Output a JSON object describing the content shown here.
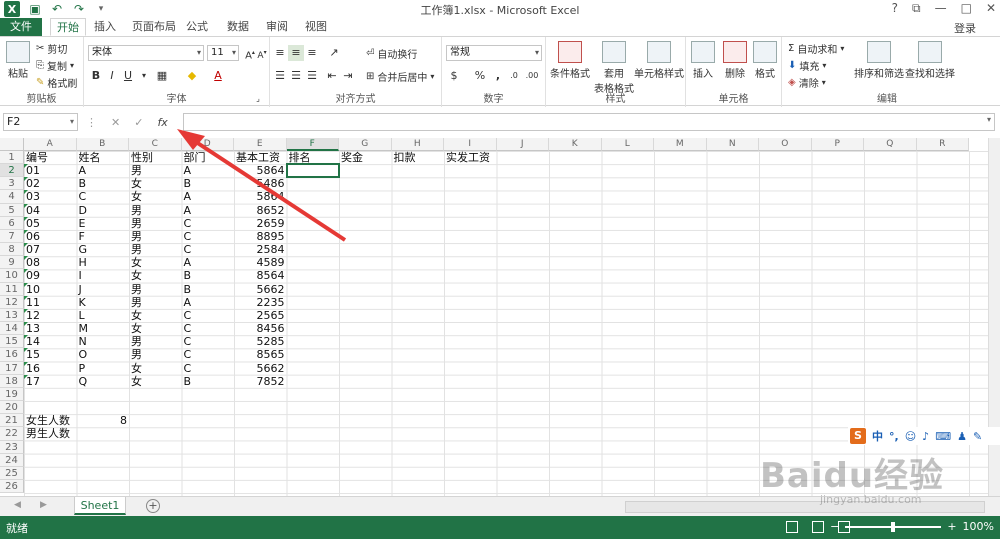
{
  "window": {
    "title": "工作簿1.xlsx - Microsoft Excel",
    "login": "登录",
    "help": "?"
  },
  "tabs": [
    "文件",
    "开始",
    "插入",
    "页面布局",
    "公式",
    "数据",
    "审阅",
    "视图"
  ],
  "ribbon": {
    "clipboard": {
      "label": "剪贴板",
      "paste": "粘贴",
      "cut": "剪切",
      "copy": "复制",
      "format_painter": "格式刷"
    },
    "font": {
      "label": "字体",
      "name": "宋体",
      "size": "11"
    },
    "alignment": {
      "label": "对齐方式",
      "wrap": "自动换行",
      "merge": "合并后居中"
    },
    "number": {
      "label": "数字",
      "format": "常规",
      "percent": "%"
    },
    "styles": {
      "label": "样式",
      "conditional": "条件格式",
      "table_format_1": "套用",
      "table_format_2": "表格格式",
      "cell_styles": "单元格样式"
    },
    "cells": {
      "label": "单元格",
      "insert": "插入",
      "delete": "删除",
      "format": "格式"
    },
    "editing": {
      "label": "编辑",
      "autosum": "自动求和",
      "fill": "填充",
      "clear": "清除",
      "sort_filter": "排序和筛选",
      "find_select": "查找和选择"
    }
  },
  "formula_bar": {
    "name_box": "F2",
    "fx": "fx",
    "content": ""
  },
  "columns": [
    "A",
    "B",
    "C",
    "D",
    "E",
    "F",
    "G",
    "H",
    "I",
    "J",
    "K",
    "L",
    "M",
    "N",
    "O",
    "P",
    "Q",
    "R"
  ],
  "selected_column": "F",
  "rows": [
    "1",
    "2",
    "3",
    "4",
    "5",
    "6",
    "7",
    "8",
    "9",
    "10",
    "11",
    "12",
    "13",
    "14",
    "15",
    "16",
    "17",
    "18",
    "19",
    "20",
    "21",
    "22",
    "23",
    "24",
    "25",
    "26"
  ],
  "selected_row": "2",
  "headers": [
    "编号",
    "姓名",
    "性别",
    "部门",
    "基本工资",
    "排名",
    "奖金",
    "扣款",
    "实发工资"
  ],
  "data_rows": [
    [
      "01",
      "A",
      "男",
      "A",
      "5864"
    ],
    [
      "02",
      "B",
      "女",
      "B",
      "5486"
    ],
    [
      "03",
      "C",
      "女",
      "A",
      "5864"
    ],
    [
      "04",
      "D",
      "男",
      "A",
      "8652"
    ],
    [
      "05",
      "E",
      "男",
      "C",
      "2659"
    ],
    [
      "06",
      "F",
      "男",
      "C",
      "8895"
    ],
    [
      "07",
      "G",
      "男",
      "C",
      "2584"
    ],
    [
      "08",
      "H",
      "女",
      "A",
      "4589"
    ],
    [
      "09",
      "I",
      "女",
      "B",
      "8564"
    ],
    [
      "10",
      "J",
      "男",
      "B",
      "5662"
    ],
    [
      "11",
      "K",
      "男",
      "A",
      "2235"
    ],
    [
      "12",
      "L",
      "女",
      "C",
      "2565"
    ],
    [
      "13",
      "M",
      "女",
      "C",
      "8456"
    ],
    [
      "14",
      "N",
      "男",
      "C",
      "5285"
    ],
    [
      "15",
      "O",
      "男",
      "C",
      "8565"
    ],
    [
      "16",
      "P",
      "女",
      "C",
      "5662"
    ],
    [
      "17",
      "Q",
      "女",
      "B",
      "7852"
    ]
  ],
  "summary": {
    "female_label": "女生人数",
    "female_count": "8",
    "male_label": "男生人数"
  },
  "sheet_tab": "Sheet1",
  "status": {
    "ready": "就绪",
    "zoom": "100%"
  },
  "overlay": {
    "ime_label": "中",
    "watermark": "Baidu经验",
    "watermark_url": "jingyan.baidu.com"
  },
  "colors": {
    "excel_green": "#217346",
    "arrow_red": "#e53935"
  }
}
